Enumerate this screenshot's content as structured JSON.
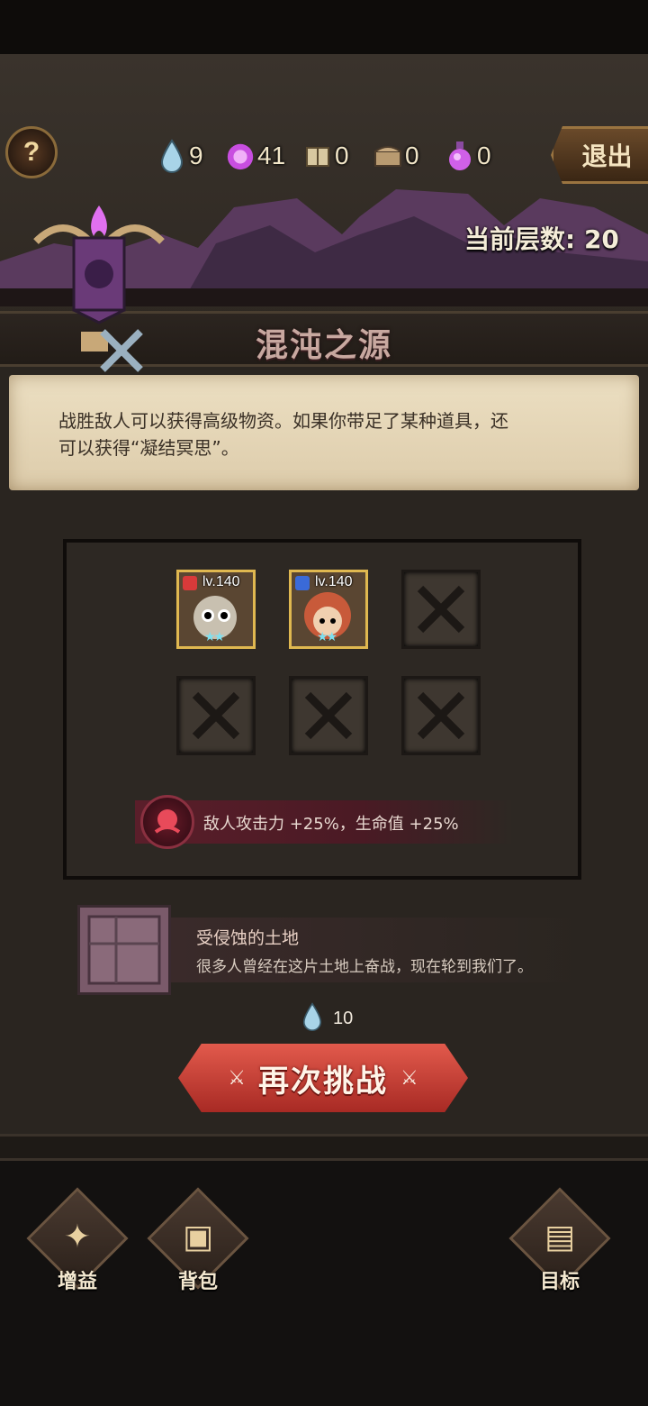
{
  "header": {
    "help_label": "?",
    "resources": [
      {
        "icon": "water-drop-icon",
        "value": "9"
      },
      {
        "icon": "purple-orb-icon",
        "value": "41"
      },
      {
        "icon": "crate-icon",
        "value": "0"
      },
      {
        "icon": "chest-icon",
        "value": "0"
      },
      {
        "icon": "potion-icon",
        "value": "0"
      }
    ],
    "exit_label": "退出",
    "floor_label": "当前层数: 20"
  },
  "stage": {
    "title": "混沌之源",
    "description_line1": "战胜敌人可以获得高级物资。如果你带足了某种道具，还",
    "description_line2": "可以获得“凝结冥思”。"
  },
  "team": {
    "heroes": [
      {
        "level": "lv.140",
        "class_color": "#d83a3a",
        "stars": "★★"
      },
      {
        "level": "lv.140",
        "class_color": "#3a6ad8",
        "stars": "★★"
      }
    ],
    "modifier_text": "敌人攻击力 +25%，生命值 +25%"
  },
  "terrain": {
    "title": "受侵蚀的土地",
    "description": "很多人曾经在这片土地上奋战，现在轮到我们了。"
  },
  "cost": {
    "icon": "water-drop-icon",
    "value": "10"
  },
  "challenge_label": "再次挑战",
  "nav": [
    {
      "label": "增益",
      "icon": "blessing-icon"
    },
    {
      "label": "背包",
      "icon": "backpack-icon"
    },
    {
      "label": "目标",
      "icon": "treasure-chest-icon"
    }
  ],
  "colors": {
    "accent_red": "#c8423a",
    "gold_border": "#e0b850",
    "parchment": "#e6d7b8"
  }
}
